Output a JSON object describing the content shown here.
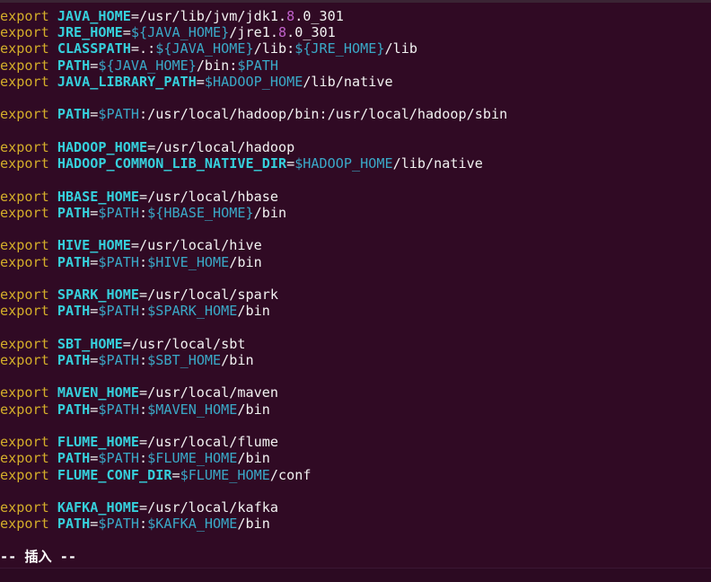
{
  "editor": {
    "lines": [
      "export JAVA_HOME=/usr/lib/jvm/jdk1.8.0_301",
      "export JRE_HOME=${JAVA_HOME}/jre1.8.0_301",
      "export CLASSPATH=.:${JAVA_HOME}/lib:${JRE_HOME}/lib",
      "export PATH=${JAVA_HOME}/bin:$PATH",
      "export JAVA_LIBRARY_PATH=$HADOOP_HOME/lib/native",
      "",
      "export PATH=$PATH:/usr/local/hadoop/bin:/usr/local/hadoop/sbin",
      "",
      "export HADOOP_HOME=/usr/local/hadoop",
      "export HADOOP_COMMON_LIB_NATIVE_DIR=$HADOOP_HOME/lib/native",
      "",
      "export HBASE_HOME=/usr/local/hbase",
      "export PATH=$PATH:${HBASE_HOME}/bin",
      "",
      "export HIVE_HOME=/usr/local/hive",
      "export PATH=$PATH:$HIVE_HOME/bin",
      "",
      "export SPARK_HOME=/usr/local/spark",
      "export PATH=$PATH:$SPARK_HOME/bin",
      "",
      "export SBT_HOME=/usr/local/sbt",
      "export PATH=$PATH:$SBT_HOME/bin",
      "",
      "export MAVEN_HOME=/usr/local/maven",
      "export PATH=$PATH:$MAVEN_HOME/bin",
      "",
      "export FLUME_HOME=/usr/local/flume",
      "export PATH=$PATH:$FLUME_HOME/bin",
      "export FLUME_CONF_DIR=$FLUME_HOME/conf",
      "",
      "export KAFKA_HOME=/usr/local/kafka",
      "export PATH=$PATH:$KAFKA_HOME/bin",
      ""
    ],
    "mode_indicator": "-- 插入 --"
  },
  "colors": {
    "background": "#300a24",
    "keyword": "#d4ae2a",
    "variable_name": "#36d0dc",
    "variable_reference": "#3aa9c8",
    "number": "#c061cb",
    "text": "#f2f2f2"
  }
}
